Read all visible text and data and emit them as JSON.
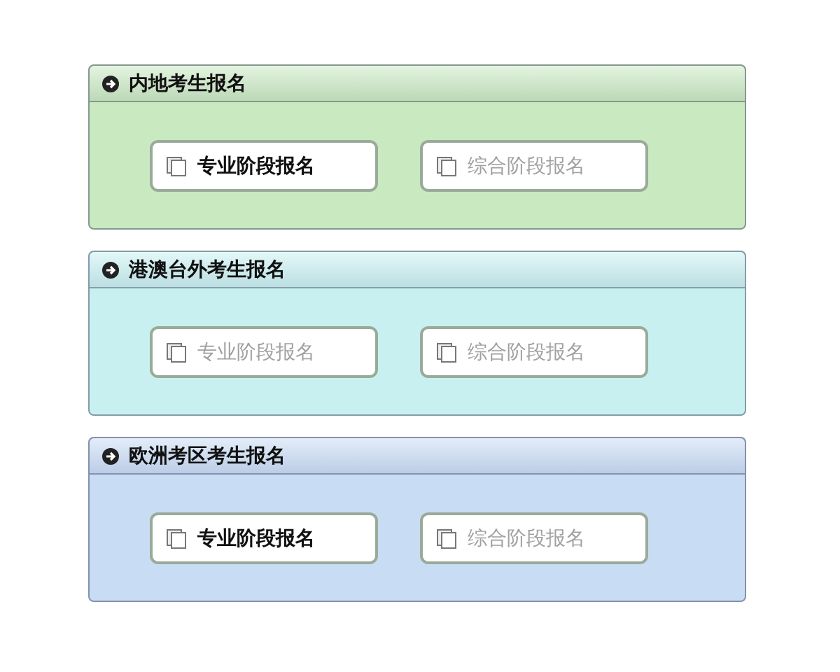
{
  "sections": [
    {
      "title": "内地考生报名",
      "color": "#c9e9c0",
      "buttons": [
        {
          "label": "专业阶段报名",
          "disabled": false
        },
        {
          "label": "综合阶段报名",
          "disabled": true
        }
      ]
    },
    {
      "title": "港澳台外考生报名",
      "color": "#c8f0f0",
      "buttons": [
        {
          "label": "专业阶段报名",
          "disabled": true
        },
        {
          "label": "综合阶段报名",
          "disabled": true
        }
      ]
    },
    {
      "title": "欧洲考区考生报名",
      "color": "#c8dcf4",
      "buttons": [
        {
          "label": "专业阶段报名",
          "disabled": false
        },
        {
          "label": "综合阶段报名",
          "disabled": true
        }
      ]
    }
  ]
}
